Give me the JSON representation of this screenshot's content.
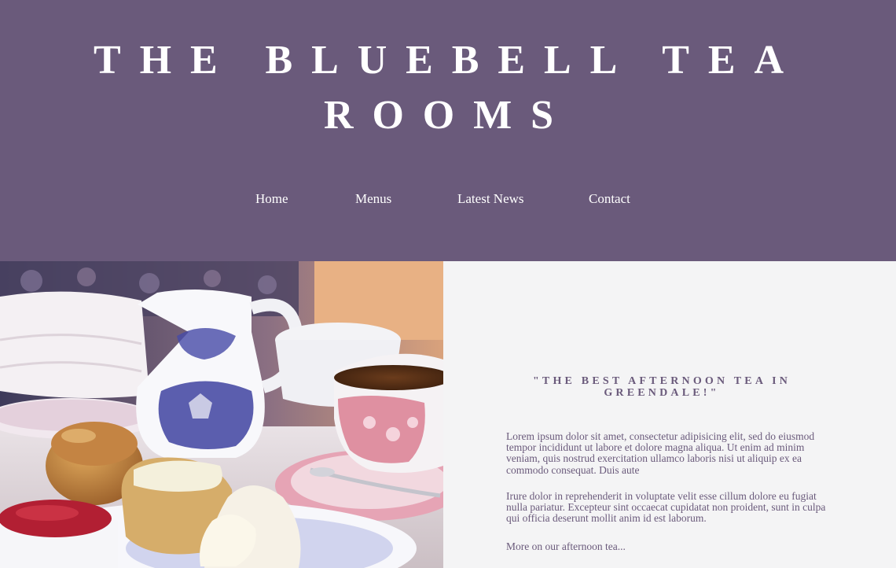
{
  "header": {
    "title": "THE BLUEBELL TEA ROOMS"
  },
  "nav": {
    "items": [
      {
        "label": "Home"
      },
      {
        "label": "Menus"
      },
      {
        "label": "Latest News"
      },
      {
        "label": "Contact"
      }
    ]
  },
  "hero": {
    "image_description": "afternoon tea photo-placeholder"
  },
  "content": {
    "quote": "\"THE BEST AFTERNOON TEA IN GREENDALE!\"",
    "paragraph_1": "Lorem ipsum dolor sit amet, consectetur adipisicing elit, sed do eiusmod tempor incididunt ut labore et dolore magna aliqua. Ut enim ad minim veniam, quis nostrud exercitation ullamco laboris nisi ut aliquip ex ea commodo consequat. Duis aute",
    "paragraph_2": "Irure dolor in reprehenderit in voluptate velit esse cillum dolore eu fugiat nulla pariatur. Excepteur sint occaecat cupidatat non proident, sunt in culpa qui officia deserunt mollit anim id est laborum.",
    "more_link": "More on our afternoon tea..."
  },
  "colors": {
    "header_bg": "#6a5a7b",
    "panel_bg": "#f4f4f5",
    "text_accent": "#6a5a7b"
  }
}
